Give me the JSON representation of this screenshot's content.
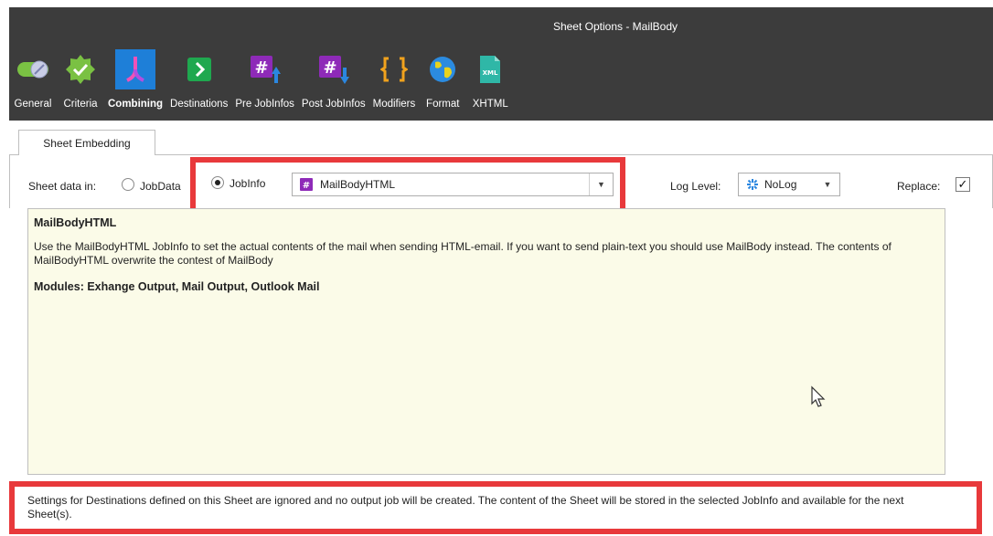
{
  "window": {
    "title": "Sheet Options - MailBody"
  },
  "toolbar": {
    "items": [
      {
        "label": "General",
        "icon": "toggle-icon"
      },
      {
        "label": "Criteria",
        "icon": "badge-check-icon"
      },
      {
        "label": "Combining",
        "icon": "merge-icon",
        "active": true
      },
      {
        "label": "Destinations",
        "icon": "arrow-right-icon"
      },
      {
        "label": "Pre JobInfos",
        "icon": "hash-up-icon"
      },
      {
        "label": "Post JobInfos",
        "icon": "hash-down-icon"
      },
      {
        "label": "Modifiers",
        "icon": "brackets-icon"
      },
      {
        "label": "Format",
        "icon": "globe-icon"
      },
      {
        "label": "XHTML",
        "icon": "xml-file-icon"
      }
    ]
  },
  "tabs": {
    "sheet_embedding": "Sheet Embedding"
  },
  "options": {
    "sheet_data_in_label": "Sheet data in:",
    "radio_jobdata_label": "JobData",
    "radio_jobinfo_label": "JobInfo",
    "jobinfo_value": "MailBodyHTML",
    "log_level_label": "Log Level:",
    "log_level_value": "NoLog",
    "replace_label": "Replace:",
    "replace_checked": true
  },
  "description": {
    "title": "MailBodyHTML",
    "body": "Use the MailBodyHTML JobInfo to set the actual contents of the mail when sending HTML-email. If you want to send plain-text you should use MailBody instead. The contents of MailBodyHTML overwrite the contest of MailBody",
    "modules": "Modules: Exhange Output, Mail Output, Outlook Mail"
  },
  "footer": {
    "note": "Settings for Destinations defined on this Sheet are ignored and no output job will be created. The content of the Sheet will be stored in the selected JobInfo and available for the next Sheet(s)."
  },
  "colors": {
    "toolbar_bg": "#3c3c3c",
    "active_tool": "#1e7fd8",
    "highlight": "#e8393b",
    "description_bg": "#fbfbe8"
  }
}
